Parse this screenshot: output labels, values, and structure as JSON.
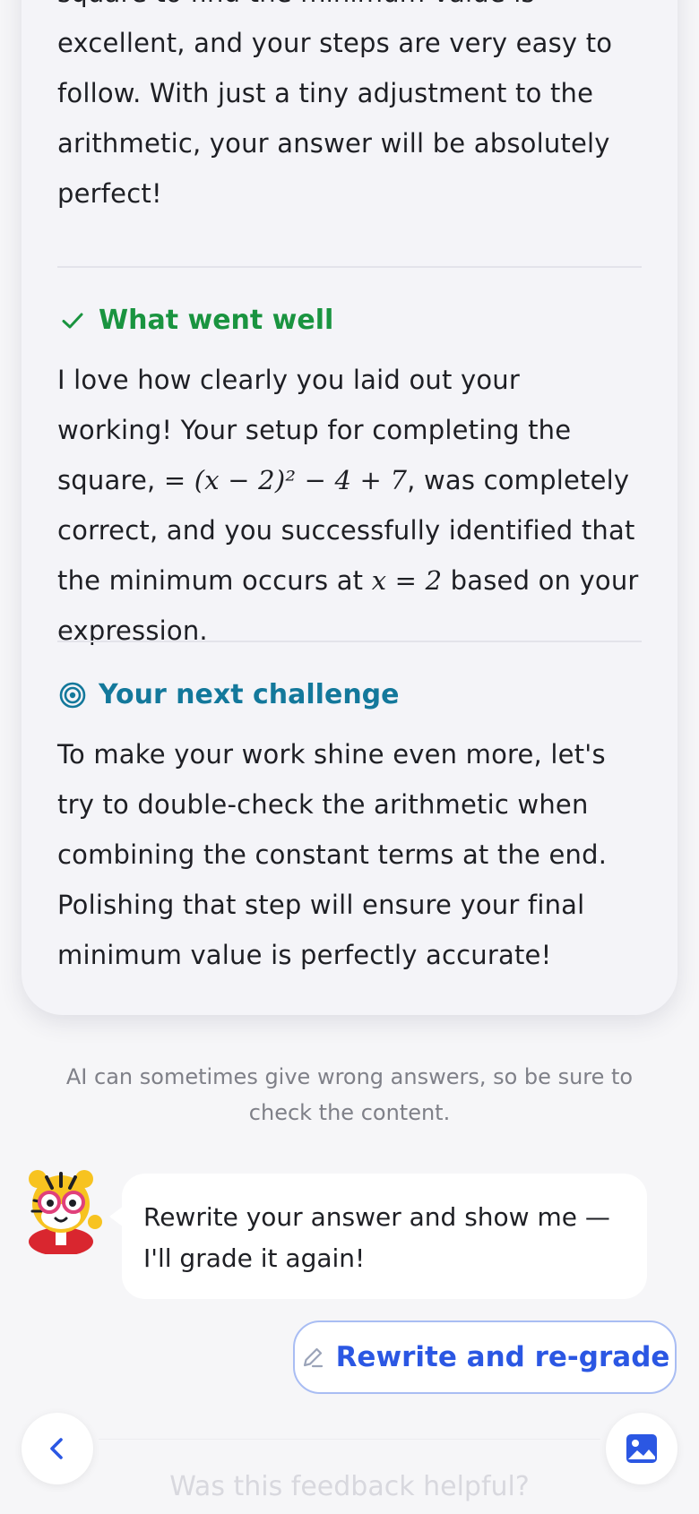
{
  "intro": {
    "line1": "square to find the minimum value is",
    "rest": "excellent, and your steps are very easy to follow. With just a tiny adjustment to the arithmetic, your answer will be absolutely perfect!"
  },
  "went_well": {
    "title": "What went well",
    "text_a": "I love how clearly you laid out your working! Your setup for completing the square, ",
    "math_setup": "= (x − 2)² − 4 + 7",
    "text_b": ", was completely correct, and you successfully identified that the minimum occurs at ",
    "math_min": "x = 2",
    "text_c": " based on your expression."
  },
  "next_challenge": {
    "title": "Your next challenge",
    "text": "To make your work shine even more, let's try to double-check the arithmetic when combining the constant terms at the end. Polishing that step will ensure your final minimum value is perfectly accurate!"
  },
  "disclaimer": "AI can sometimes give wrong answers, so be sure to check the content.",
  "assistant_message": "Rewrite your answer and show me — I'll grade it again!",
  "rewrite_button_label": "Rewrite and re-grade",
  "feedback_question": "Was this feedback helpful?",
  "colors": {
    "success": "#1a9440",
    "challenge": "#13789b",
    "accent": "#2b57e3"
  },
  "icons": {
    "went_well": "check-icon",
    "challenge": "target-icon",
    "rewrite": "pencil-icon",
    "back": "chevron-left-icon",
    "image": "image-icon",
    "avatar": "tiger-mascot-icon"
  }
}
